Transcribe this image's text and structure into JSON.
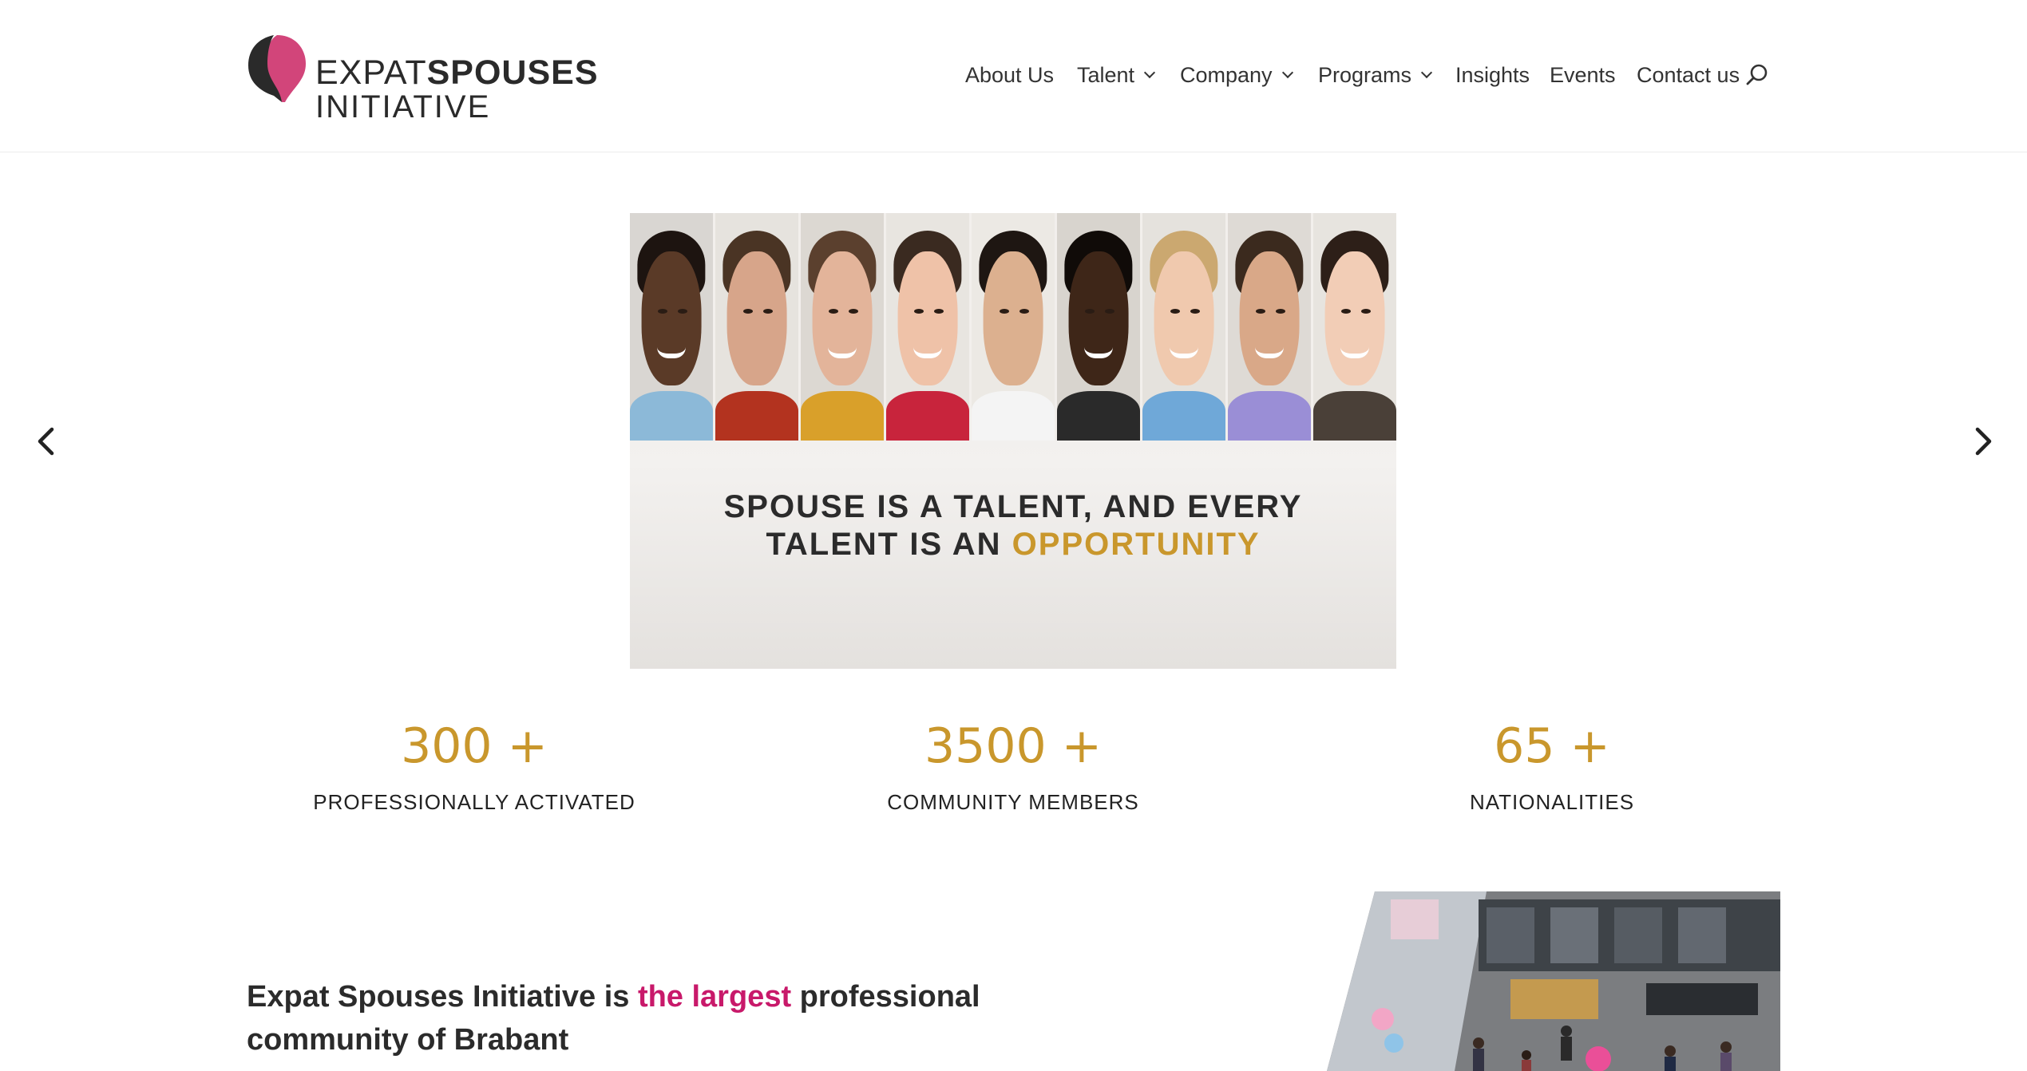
{
  "header": {
    "logo": {
      "line1_thin": "EXPAT",
      "line1_bold": "SPOUSES",
      "line2": "INITIATIVE",
      "mark_colors": {
        "dark": "#2a2a2a",
        "pink": "#d2457a"
      }
    },
    "nav": [
      {
        "label": "About Us",
        "has_dropdown": false
      },
      {
        "label": "Talent",
        "has_dropdown": true
      },
      {
        "label": "Company",
        "has_dropdown": true
      },
      {
        "label": "Programs",
        "has_dropdown": true
      },
      {
        "label": "Insights",
        "has_dropdown": false
      },
      {
        "label": "Events",
        "has_dropdown": false
      },
      {
        "label": "Contact us",
        "has_dropdown": false
      }
    ],
    "search_icon": "search-icon"
  },
  "slider": {
    "prev_icon": "chevron-left-icon",
    "next_icon": "chevron-right-icon",
    "slide": {
      "line1": "SPOUSE IS A TALENT, AND EVERY",
      "line2_prefix": "TALENT IS AN ",
      "line2_accent": "OPPORTUNITY"
    }
  },
  "stats": [
    {
      "number": "300 +",
      "label": "PROFESSIONALLY ACTIVATED"
    },
    {
      "number": "3500 +",
      "label": "COMMUNITY MEMBERS"
    },
    {
      "number": "65 +",
      "label": "NATIONALITIES"
    }
  ],
  "intro": {
    "part1": "Expat Spouses Initiative is ",
    "highlight": "the largest",
    "part2": " professional",
    "line2": "community of Brabant"
  },
  "colors": {
    "accent_gold": "#c9972c",
    "accent_pink": "#c8196a",
    "text_dark": "#2b2b2b"
  }
}
